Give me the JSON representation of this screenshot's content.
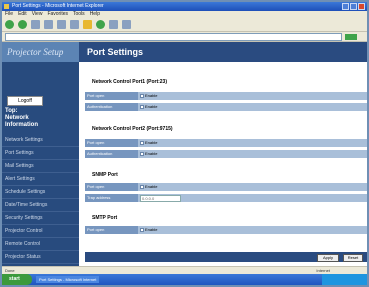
{
  "window": {
    "title": "Port Settings - Microsoft Internet Explorer",
    "menu": [
      "File",
      "Edit",
      "View",
      "Favorites",
      "Tools",
      "Help"
    ]
  },
  "logo": "Projector Setup",
  "logout_label": "Logoff",
  "nav_heading": [
    "Top:",
    "Network",
    "Information"
  ],
  "nav_items": [
    "Network Settings",
    "Port Settings",
    "Mail Settings",
    "Alert Settings",
    "Schedule Settings",
    "Date/Time Settings",
    "Security Settings",
    "Projector Control",
    "Remote Control",
    "Projector Status"
  ],
  "page_title": "Port Settings",
  "sections": {
    "port1": {
      "title": "Network Control Port1 (Port:23)",
      "rows": [
        {
          "label": "Port open",
          "value": "Enable"
        },
        {
          "label": "Authentication",
          "value": "Enable"
        }
      ]
    },
    "port2": {
      "title": "Network Control Port2 (Port:9715)",
      "rows": [
        {
          "label": "Port open",
          "value": "Enable"
        },
        {
          "label": "Authentication",
          "value": "Enable"
        }
      ]
    },
    "snmp": {
      "title": "SNMP Port",
      "rows": [
        {
          "label": "Port open",
          "value": "Enable"
        },
        {
          "label": "Trap address",
          "value": "0.0.0.0"
        }
      ]
    },
    "smtp": {
      "title": "SMTP Port",
      "rows": [
        {
          "label": "Port open",
          "value": "Enable"
        }
      ]
    }
  },
  "buttons": {
    "apply": "Apply",
    "reset": "Reset"
  },
  "status": {
    "left": "Done",
    "right": "Internet"
  },
  "taskbar": {
    "start": "start"
  }
}
